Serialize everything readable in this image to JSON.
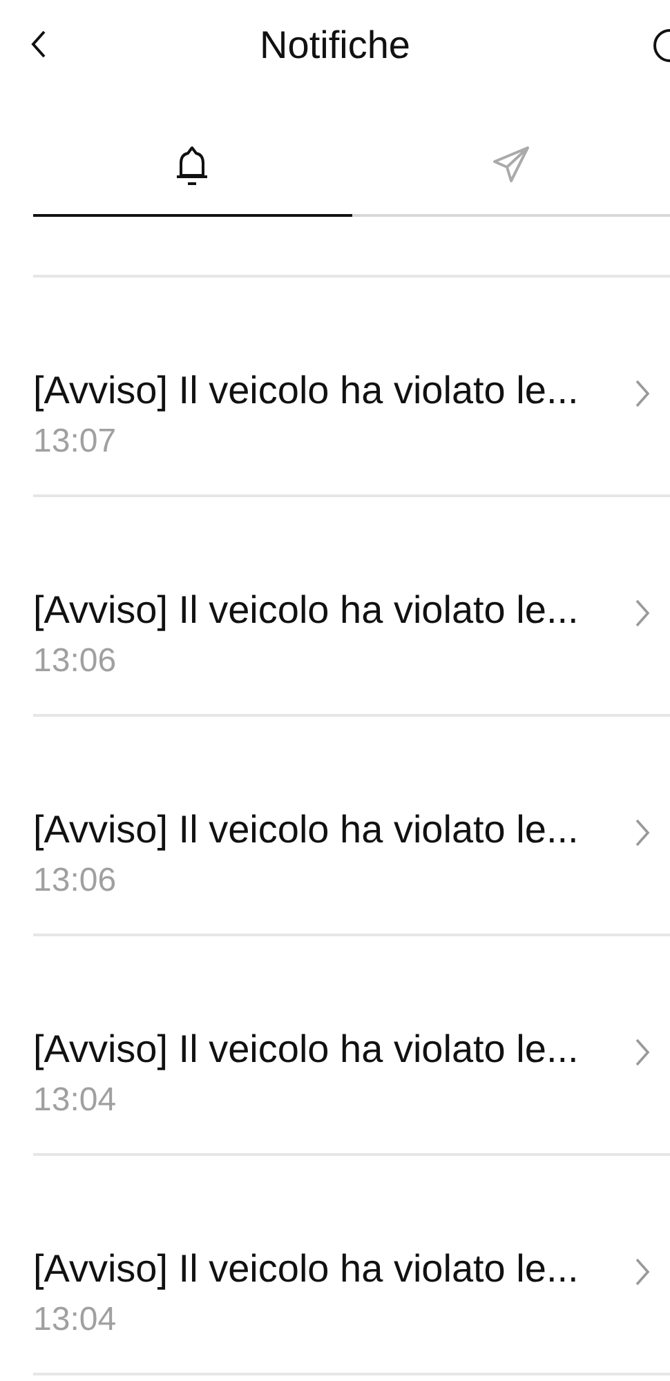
{
  "header": {
    "title": "Notifiche"
  },
  "tabs": [
    {
      "kind": "bell",
      "selected": true
    },
    {
      "kind": "send",
      "selected": false
    }
  ],
  "notifications": [
    {
      "title": "[Avviso] Il veicolo ha violato le...",
      "time": "13:07"
    },
    {
      "title": "[Avviso] Il veicolo ha violato le...",
      "time": "13:06"
    },
    {
      "title": "[Avviso] Il veicolo ha violato le...",
      "time": "13:06"
    },
    {
      "title": "[Avviso] Il veicolo ha violato le...",
      "time": "13:04"
    },
    {
      "title": "[Avviso] Il veicolo ha violato le...",
      "time": "13:04"
    }
  ]
}
